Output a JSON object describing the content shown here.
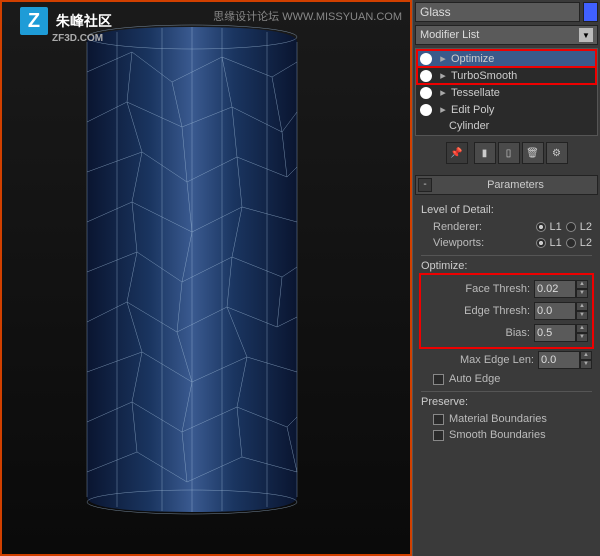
{
  "watermark_top": "思缘设计论坛  WWW.MISSYUAN.COM",
  "logo": {
    "text": "朱峰社区",
    "sub": "ZF3D.COM"
  },
  "panel": {
    "object_name": "Glass",
    "modifier_list_label": "Modifier List",
    "modifiers": [
      {
        "name": "Optimize",
        "highlighted": true,
        "selected": true,
        "expandable": true
      },
      {
        "name": "TurboSmooth",
        "highlighted": true,
        "selected": false,
        "expandable": true
      },
      {
        "name": "Tessellate",
        "highlighted": false,
        "selected": false,
        "expandable": true
      },
      {
        "name": "Edit Poly",
        "highlighted": false,
        "selected": false,
        "expandable": true
      }
    ],
    "base_object": "Cylinder",
    "rollout": {
      "title": "Parameters",
      "level_of_detail_label": "Level of Detail:",
      "renderer_label": "Renderer:",
      "viewports_label": "Viewports:",
      "radio_l1": "L1",
      "radio_l2": "L2",
      "optimize_label": "Optimize:",
      "face_thresh_label": "Face Thresh:",
      "face_thresh_value": "0.02",
      "edge_thresh_label": "Edge Thresh:",
      "edge_thresh_value": "0.0",
      "bias_label": "Bias:",
      "bias_value": "0.5",
      "max_edge_label": "Max Edge Len:",
      "max_edge_value": "0.0",
      "auto_edge_label": "Auto Edge",
      "preserve_label": "Preserve:",
      "material_bounds_label": "Material Boundaries",
      "smooth_bounds_label": "Smooth Boundaries"
    }
  }
}
